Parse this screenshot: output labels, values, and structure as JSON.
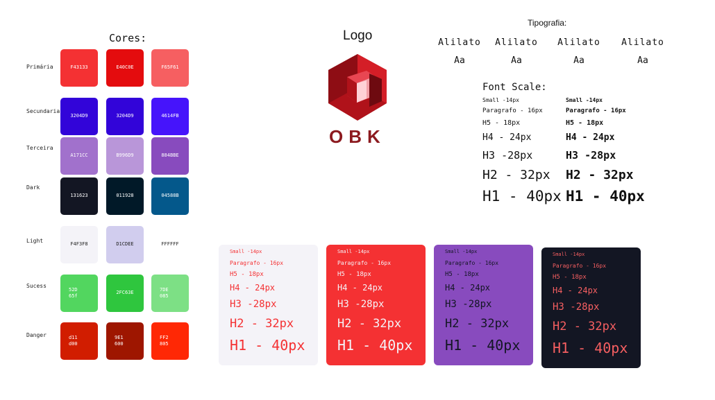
{
  "cores": {
    "title": "Cores:",
    "rows": [
      {
        "label": "Primária",
        "swatches": [
          {
            "color": "#F43133",
            "text": "F43133",
            "text_color": "#ffffff"
          },
          {
            "color": "#E40C0E",
            "text": "E40C0E",
            "text_color": "#ffffff"
          },
          {
            "color": "#F65F61",
            "text": "F65F61",
            "text_color": "#ffffff"
          }
        ]
      },
      {
        "label": "Secundaria",
        "swatches": [
          {
            "color": "#3204D9",
            "text": "3204D9",
            "text_color": "#ffffff"
          },
          {
            "color": "#3204D9",
            "text": "3204D9",
            "text_color": "#ffffff"
          },
          {
            "color": "#4614FB",
            "text": "4614FB",
            "text_color": "#ffffff"
          }
        ]
      },
      {
        "label": "Terceira",
        "swatches": [
          {
            "color": "#A171CC",
            "text": "A171CC",
            "text_color": "#ffffff"
          },
          {
            "color": "#B996D9",
            "text": "B996D9",
            "text_color": "#ffffff"
          },
          {
            "color": "#884BBE",
            "text": "884BBE",
            "text_color": "#ffffff"
          }
        ]
      },
      {
        "label": "Dark",
        "swatches": [
          {
            "color": "#131623",
            "text": "131623",
            "text_color": "#ffffff"
          },
          {
            "color": "#011928",
            "text": "011928",
            "text_color": "#ffffff"
          },
          {
            "color": "#04588B",
            "text": "04588B",
            "text_color": "#ffffff"
          }
        ]
      },
      {
        "label": "Light",
        "swatches": [
          {
            "color": "#F4F3F8",
            "text": "F4F3F8",
            "text_color": "#222222"
          },
          {
            "color": "#D1CDEE",
            "text": "D1CDEE",
            "text_color": "#222222"
          },
          {
            "color": "#FFFFFF",
            "text": "FFFFFF",
            "text_color": "#222222"
          }
        ]
      },
      {
        "label": "Sucess",
        "swatches": [
          {
            "color": "#52D65F",
            "text": "52D\n65f",
            "text_color": "#ffffff"
          },
          {
            "color": "#2FC63E",
            "text": "2FC63E",
            "text_color": "#ffffff"
          },
          {
            "color": "#7DE085",
            "text": "7DE\n085",
            "text_color": "#ffffff"
          }
        ]
      },
      {
        "label": "Danger",
        "swatches": [
          {
            "color": "#D11D00",
            "text": "d11\nd00",
            "text_color": "#ffffff"
          },
          {
            "color": "#9E1600",
            "text": "9E1\n600",
            "text_color": "#ffffff"
          },
          {
            "color": "#FF2805",
            "text": "FF2\n805",
            "text_color": "#ffffff"
          }
        ]
      }
    ]
  },
  "logo": {
    "title": "Logo",
    "brand_text": "OBK",
    "icon": "hexagon-cube-logo",
    "brand_color": "#8C1A1F"
  },
  "tipografia": {
    "title": "Tipografia:",
    "samples": [
      {
        "name": "Alilato",
        "aa": "Aa"
      },
      {
        "name": "Alilato",
        "aa": "Aa"
      },
      {
        "name": "Alilato",
        "aa": "Aa"
      },
      {
        "name": "Alilato",
        "aa": "Aa"
      }
    ]
  },
  "font_scale": {
    "title": "Font Scale:",
    "items": [
      "Small -14px",
      "Paragrafo - 16px",
      "H5 - 18px",
      "H4 - 24px",
      "H3 -28px",
      "H2 - 32px",
      "H1 - 40px"
    ]
  },
  "cards": [
    {
      "bg": "#F4F3F8",
      "fg": "#F43133"
    },
    {
      "bg": "#F43133",
      "fg": "#F4F3F8"
    },
    {
      "bg": "#884BBE",
      "fg": "#131623"
    },
    {
      "bg": "#131623",
      "fg": "#F65F61"
    }
  ]
}
